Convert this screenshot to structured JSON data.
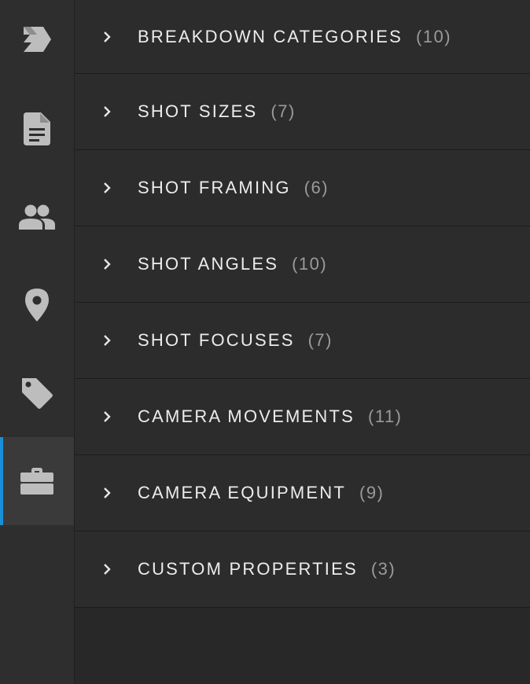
{
  "sidebar": {
    "items": [
      {
        "name": "logo-icon",
        "active": false
      },
      {
        "name": "document-icon",
        "active": false
      },
      {
        "name": "people-icon",
        "active": false
      },
      {
        "name": "location-pin-icon",
        "active": false
      },
      {
        "name": "tag-icon",
        "active": false
      },
      {
        "name": "toolbox-icon",
        "active": true
      }
    ],
    "accent_color": "#1a8fd8"
  },
  "categories": [
    {
      "label": "BREAKDOWN CATEGORIES",
      "count": "(10)"
    },
    {
      "label": "SHOT SIZES",
      "count": "(7)"
    },
    {
      "label": "SHOT FRAMING",
      "count": "(6)"
    },
    {
      "label": "SHOT ANGLES",
      "count": "(10)"
    },
    {
      "label": "SHOT FOCUSES",
      "count": "(7)"
    },
    {
      "label": "CAMERA MOVEMENTS",
      "count": "(11)"
    },
    {
      "label": "CAMERA EQUIPMENT",
      "count": "(9)"
    },
    {
      "label": "CUSTOM PROPERTIES",
      "count": "(3)"
    }
  ]
}
